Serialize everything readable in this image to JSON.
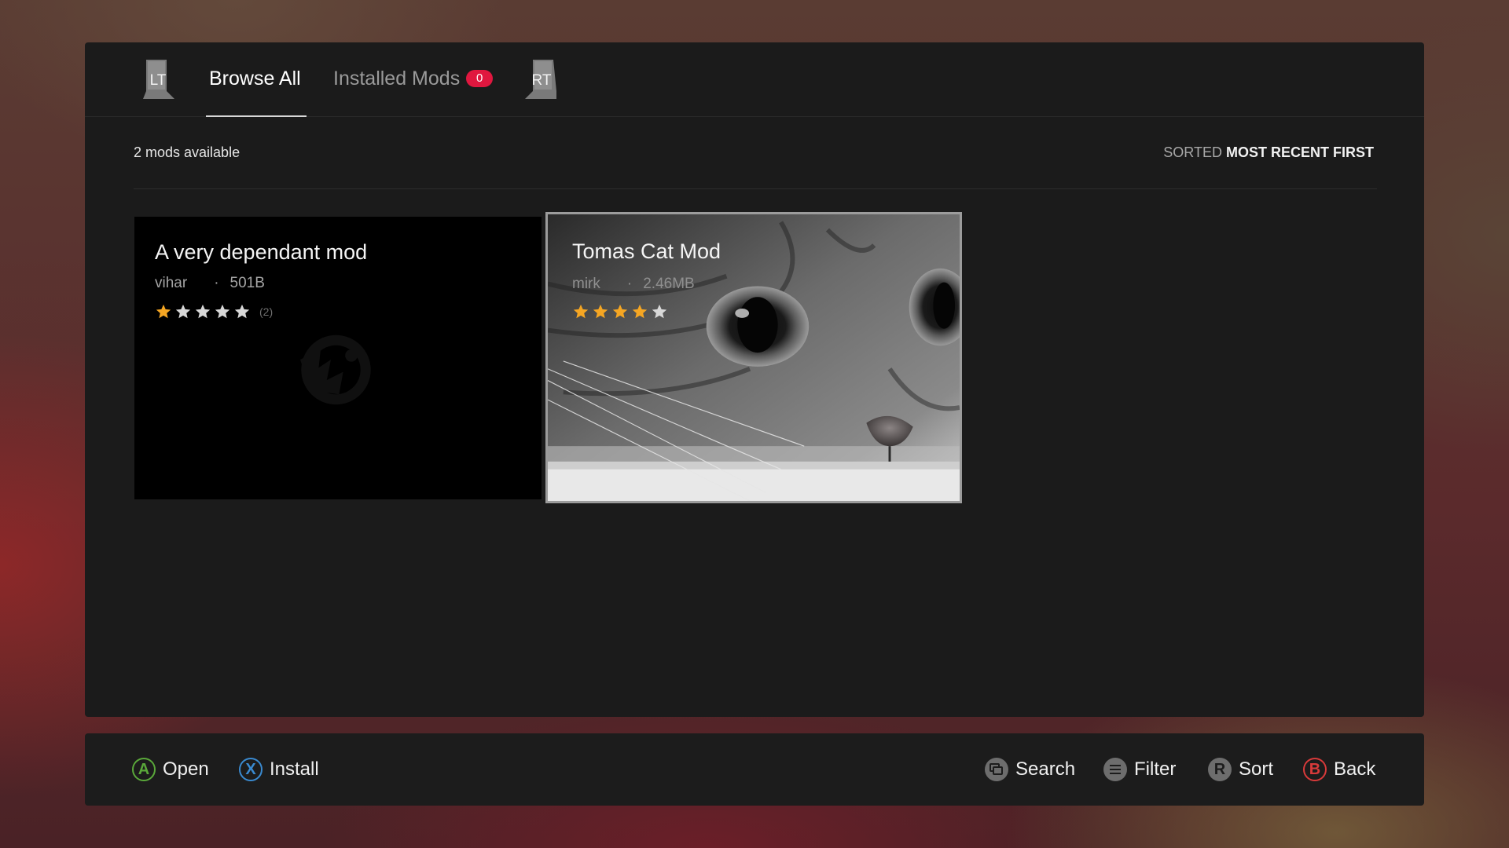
{
  "tabs": {
    "left_trigger": "LT",
    "right_trigger": "RT",
    "browse_all": "Browse All",
    "installed_mods": "Installed Mods",
    "installed_count": "0"
  },
  "info": {
    "mods_available": "2 mods available",
    "sorted_label": "SORTED",
    "sorted_value": "MOST RECENT FIRST"
  },
  "mods": [
    {
      "title": "A very dependant mod",
      "author": "vihar",
      "separator": "·",
      "size": "501B",
      "rating": 1,
      "rating_count": "(2)",
      "thumbnail": "faction-emblem-icon"
    },
    {
      "title": "Tomas Cat Mod",
      "author": "mirk",
      "separator": "·",
      "size": "2.46MB",
      "rating": 4,
      "thumbnail": "cat-photo",
      "selected": true
    }
  ],
  "hints": {
    "open": {
      "button": "A",
      "label": "Open"
    },
    "install": {
      "button": "X",
      "label": "Install"
    },
    "search": {
      "button": "view-icon",
      "label": "Search"
    },
    "filter": {
      "button": "menu-icon",
      "label": "Filter"
    },
    "sort": {
      "button": "R",
      "label": "Sort"
    },
    "back": {
      "button": "B",
      "label": "Back"
    }
  },
  "colors": {
    "star_filled": "#f5a623",
    "star_empty": "#d8d8d8",
    "badge": "#e0173f",
    "button_a": "#5aa83a",
    "button_x": "#3a8ad0",
    "button_b": "#d83a3a"
  }
}
